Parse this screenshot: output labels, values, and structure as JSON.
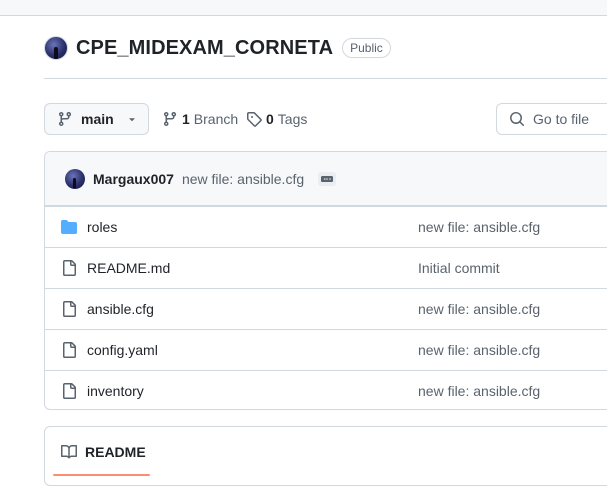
{
  "repo": {
    "name": "CPE_MIDEXAM_CORNETA",
    "visibility": "Public"
  },
  "toolbar": {
    "branch": "main",
    "branches_count": "1",
    "branches_label": "Branch",
    "tags_count": "0",
    "tags_label": "Tags",
    "search_placeholder": "Go to file"
  },
  "commit": {
    "author": "Margaux007",
    "message": "new file: ansible.cfg"
  },
  "files": [
    {
      "name": "roles",
      "type": "folder",
      "message": "new file: ansible.cfg"
    },
    {
      "name": "README.md",
      "type": "file",
      "message": "Initial commit"
    },
    {
      "name": "ansible.cfg",
      "type": "file",
      "message": "new file: ansible.cfg"
    },
    {
      "name": "config.yaml",
      "type": "file",
      "message": "new file: ansible.cfg"
    },
    {
      "name": "inventory",
      "type": "file",
      "message": "new file: ansible.cfg"
    }
  ],
  "readme": {
    "tab_label": "README"
  },
  "colors": {
    "folder": "#54aeff",
    "border": "#d1d9e0",
    "muted": "#59636e",
    "accent_underline": "#fd8c73"
  }
}
